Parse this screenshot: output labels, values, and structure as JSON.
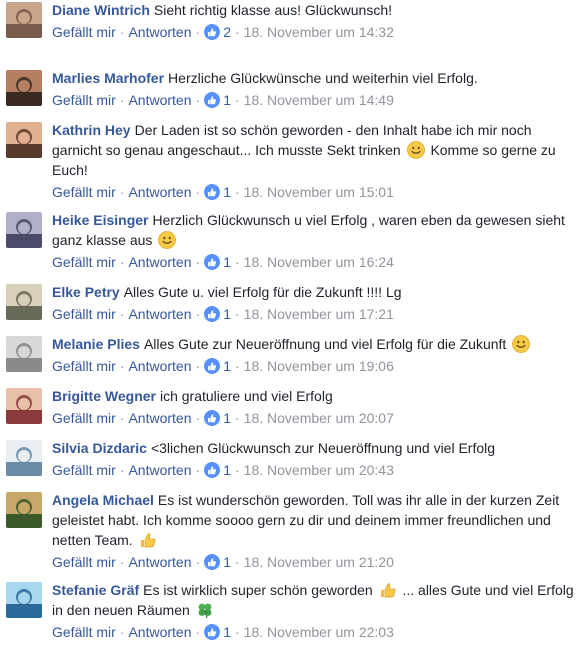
{
  "comments": [
    {
      "author": "Diane Wintrich",
      "text": "Sieht richtig klasse aus! Glückwunsch!",
      "emoji": "",
      "like_label": "Gefällt mir",
      "reply_label": "Antworten",
      "likes": "2",
      "timestamp": "18. November um 14:32",
      "avatar_colors": [
        "#7a5a4a",
        "#c9a58a"
      ]
    },
    {
      "author": "Marlies Marhofer",
      "text": "Herzliche Glückwünsche und weiterhin viel Erfolg.",
      "emoji": "",
      "like_label": "Gefällt mir",
      "reply_label": "Antworten",
      "likes": "1",
      "timestamp": "18. November um 14:49",
      "avatar_colors": [
        "#3b2a22",
        "#b57f64"
      ]
    },
    {
      "author": "Kathrin Hey",
      "text": "Der Laden ist so schön geworden - den Inhalt habe ich mir noch garnicht so genau angeschaut... Ich musste Sekt trinken",
      "emoji": "smiley-emoji",
      "text_after": "Komme so gerne zu Euch!",
      "like_label": "Gefällt mir",
      "reply_label": "Antworten",
      "likes": "1",
      "timestamp": "18. November um 15:01",
      "avatar_colors": [
        "#5a3a2a",
        "#e0b090"
      ]
    },
    {
      "author": "Heike Eisinger",
      "text": "Herzlich Glückwunsch u viel Erfolg , waren eben da gewesen sieht ganz klasse aus",
      "emoji": "smiley-emoji",
      "like_label": "Gefällt mir",
      "reply_label": "Antworten",
      "likes": "1",
      "timestamp": "18. November um 16:24",
      "avatar_colors": [
        "#4a4a6a",
        "#b0b0c8"
      ]
    },
    {
      "author": "Elke Petry",
      "text": "Alles Gute u. viel Erfolg für die Zukunft !!!! Lg",
      "emoji": "",
      "like_label": "Gefällt mir",
      "reply_label": "Antworten",
      "likes": "1",
      "timestamp": "18. November um 17:21",
      "avatar_colors": [
        "#6a6a58",
        "#d8d0b8"
      ]
    },
    {
      "author": "Melanie Plies",
      "text": "Alles Gute zur Neueröffnung und viel Erfolg für die Zukunft",
      "emoji": "smiley-emoji",
      "like_label": "Gefällt mir",
      "reply_label": "Antworten",
      "likes": "1",
      "timestamp": "18. November um 19:06",
      "avatar_colors": [
        "#8a8a8a",
        "#d8d8d8"
      ]
    },
    {
      "author": "Brigitte Wegner",
      "text": "ich gratuliere und viel Erfolg",
      "emoji": "",
      "like_label": "Gefällt mir",
      "reply_label": "Antworten",
      "likes": "1",
      "timestamp": "18. November um 20:07",
      "avatar_colors": [
        "#8a3a3a",
        "#e8c0a8"
      ]
    },
    {
      "author": "Silvia Dizdaric",
      "text": "<3lichen Glückwunsch zur Neueröffnung und viel Erfolg",
      "emoji": "",
      "like_label": "Gefällt mir",
      "reply_label": "Antworten",
      "likes": "1",
      "timestamp": "18. November um 20:43",
      "avatar_colors": [
        "#6a8aa8",
        "#e8eef2"
      ]
    },
    {
      "author": "Angela Michael",
      "text": "Es ist wunderschön geworden. Toll was ihr alle in der kurzen Zeit geleistet habt. Ich komme soooo gern zu dir und deinem immer freundlichen und netten Team.",
      "emoji": "thumbs-up-emoji",
      "like_label": "Gefällt mir",
      "reply_label": "Antworten",
      "likes": "1",
      "timestamp": "18. November um 21:20",
      "avatar_colors": [
        "#3a5a2a",
        "#c8a86a"
      ]
    },
    {
      "author": "Stefanie Gräf",
      "text": "Es ist wirklich super schön geworden",
      "emoji": "thumbs-up-emoji",
      "text_after": "... alles Gute und viel Erfolg in den neuen Räumen",
      "emoji2": "clover-emoji",
      "like_label": "Gefällt mir",
      "reply_label": "Antworten",
      "likes": "1",
      "timestamp": "18. November um 22:03",
      "avatar_colors": [
        "#2a6a9a",
        "#a8d8f0"
      ]
    }
  ],
  "colors": {
    "author": "#365899",
    "meta": "#90949c",
    "like_badge": "#5890ff",
    "text": "#1d2129"
  }
}
